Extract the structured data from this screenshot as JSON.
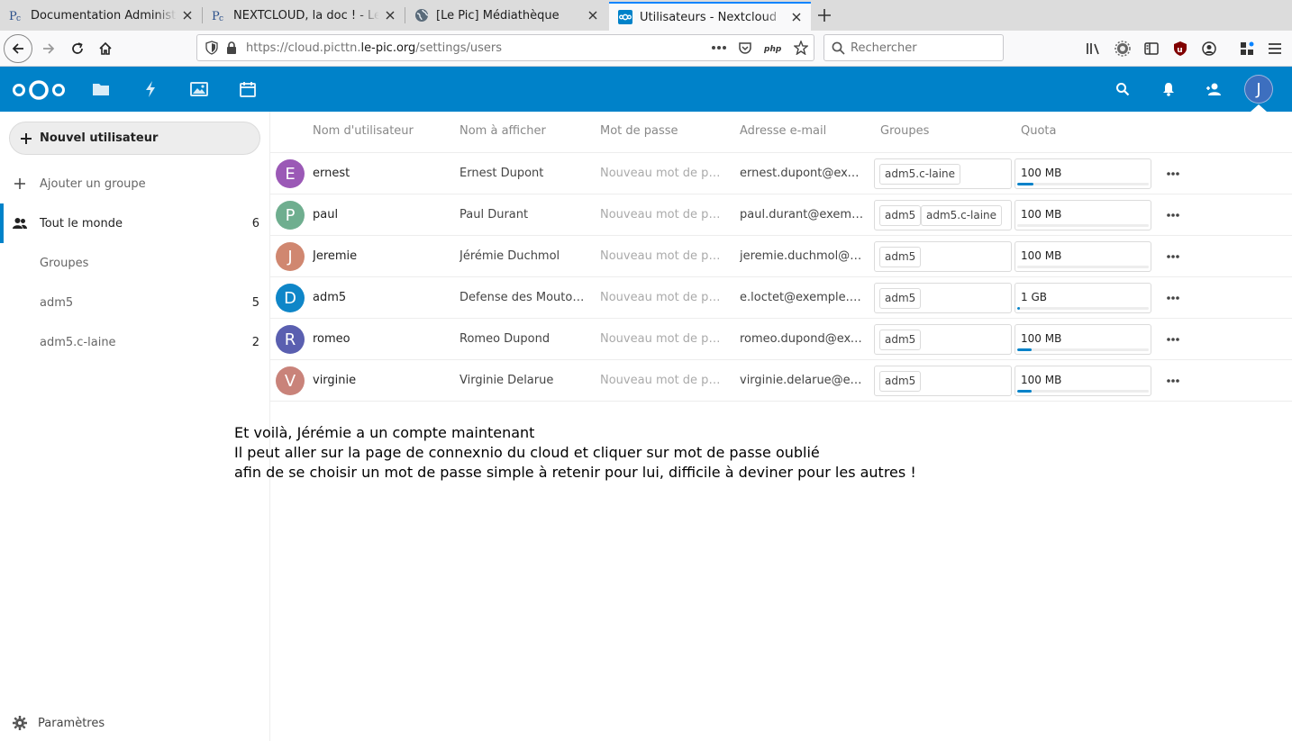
{
  "browser": {
    "tabs": [
      {
        "title": "Documentation Administra",
        "favicon": "lepic-favicon",
        "active": false
      },
      {
        "title": "NEXTCLOUD, la doc ! - Le Pic",
        "favicon": "lepic-favicon",
        "active": false
      },
      {
        "title": "[Le Pic] Médiathèque",
        "favicon": "globe-favicon",
        "active": false
      },
      {
        "title": "Utilisateurs - Nextcloud",
        "favicon": "nextcloud-favicon",
        "active": true
      }
    ],
    "url_prefix": "https://cloud.picttn.",
    "url_domain": "le-pic.org",
    "url_path": "/settings/users",
    "search_placeholder": "Rechercher",
    "accent_color": "#0a84ff"
  },
  "nextcloud": {
    "brand_color": "#0082c9",
    "header_avatar_initial": "J"
  },
  "sidebar": {
    "new_user_label": "Nouvel utilisateur",
    "add_group_label": "Ajouter un groupe",
    "everyone": {
      "label": "Tout le monde",
      "count": "6"
    },
    "groups_caption": "Groupes",
    "groups": [
      {
        "label": "adm5",
        "count": "5"
      },
      {
        "label": "adm5.c-laine",
        "count": "2"
      }
    ],
    "settings_label": "Paramètres"
  },
  "table": {
    "headers": {
      "username": "Nom d'utilisateur",
      "display_name": "Nom à afficher",
      "password": "Mot de passe",
      "email": "Adresse e-mail",
      "groups": "Groupes",
      "quota": "Quota"
    },
    "password_placeholder": "Nouveau mot de passe",
    "users": [
      {
        "initial": "E",
        "avatar_color": "#9b59b6",
        "username": "ernest",
        "display_name": "Ernest Dupont",
        "email": "ernest.dupont@exe …",
        "groups": [
          "adm5.c-laine"
        ],
        "quota": "100 MB",
        "usage": 0.12
      },
      {
        "initial": "P",
        "avatar_color": "#6fae8f",
        "username": "paul",
        "display_name": "Paul Durant",
        "email": "paul.durant@exemp …",
        "groups": [
          "adm5",
          "adm5.c-laine"
        ],
        "quota": "100 MB",
        "usage": 0.0
      },
      {
        "initial": "J",
        "avatar_color": "#d08770",
        "username": "Jeremie",
        "display_name": "Jérémie Duchmol",
        "email": "jeremie.duchmol@e …",
        "groups": [
          "adm5"
        ],
        "quota": "100 MB",
        "usage": 0.0
      },
      {
        "initial": "D",
        "avatar_color": "#0f86c8",
        "username": "adm5",
        "display_name": "Defense des Mouton…",
        "email": "e.loctet@exemple.com",
        "groups": [
          "adm5"
        ],
        "quota": "1 GB",
        "usage": 0.02
      },
      {
        "initial": "R",
        "avatar_color": "#5a5fb0",
        "username": "romeo",
        "display_name": "Romeo Dupond",
        "email": "romeo.dupond@exe …",
        "groups": [
          "adm5"
        ],
        "quota": "100 MB",
        "usage": 0.11
      },
      {
        "initial": "V",
        "avatar_color": "#c9837a",
        "username": "virginie",
        "display_name": "Virginie Delarue",
        "email": "virginie.delarue@ex …",
        "groups": [
          "adm5"
        ],
        "quota": "100 MB",
        "usage": 0.11
      }
    ]
  },
  "annotation": {
    "line1": "Et voilà, Jérémie a un compte maintenant",
    "line2": "Il peut aller sur la page de connexnio du cloud et cliquer sur mot de passe oublié",
    "line3": "afin de se choisir un mot de passe simple à retenir pour lui, difficile à deviner pour les autres !"
  }
}
